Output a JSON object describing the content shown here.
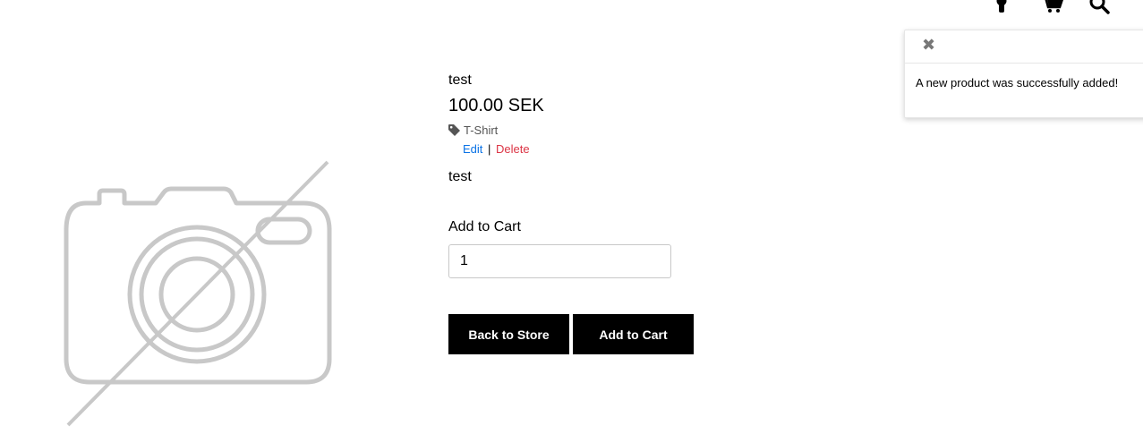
{
  "header": {
    "icons": [
      "user-icon",
      "cart-icon",
      "search-icon"
    ]
  },
  "product": {
    "title": "test",
    "price": "100.00 SEK",
    "category": "T-Shirt",
    "edit_label": "Edit",
    "separator": "|",
    "delete_label": "Delete",
    "description": "test",
    "image": "no-image-placeholder-icon"
  },
  "cart": {
    "label": "Add to Cart",
    "quantity": "1"
  },
  "buttons": {
    "back_label": "Back to Store",
    "add_label": "Add to Cart"
  },
  "toast": {
    "close_glyph": "✖",
    "message": "A new product was successfully added!"
  },
  "colors": {
    "edit_link": "#0b73e6",
    "delete_link": "#dc3545",
    "button_bg": "#000000",
    "button_text": "#ffffff"
  }
}
